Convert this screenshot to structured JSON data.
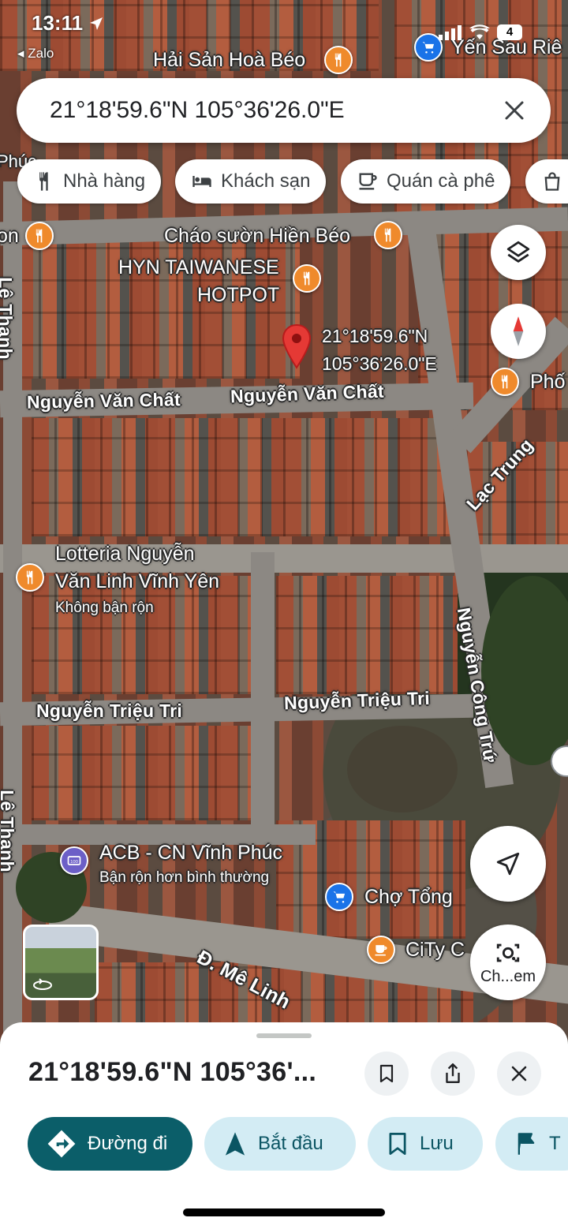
{
  "status_bar": {
    "time": "13:11",
    "back_app": "Zalo",
    "battery": "4"
  },
  "search": {
    "query": "21°18'59.6\"N 105°36'26.0\"E"
  },
  "chips": [
    {
      "label": "Nhà hàng",
      "icon": "fork-knife-icon"
    },
    {
      "label": "Khách sạn",
      "icon": "bed-icon"
    },
    {
      "label": "Quán cà phê",
      "icon": "coffee-cup-icon"
    },
    {
      "label": "",
      "icon": "shopping-bag-icon"
    }
  ],
  "map": {
    "pois": [
      {
        "name": "Hải Sản Hoà Béo",
        "type": "restaurant"
      },
      {
        "name": "Yến Sau Riê",
        "type": "shopping"
      },
      {
        "name": "Cháo sườn Hiền Béo",
        "type": "restaurant"
      },
      {
        "name_line1": "HYN TAIWANESE",
        "name_line2": "HOTPOT",
        "type": "restaurant"
      },
      {
        "name": "Phố",
        "type": "restaurant"
      },
      {
        "name_line1": "Lotteria Nguyễn",
        "name_line2": "Văn Linh Vĩnh Yên",
        "subtitle": "Không bận rộn",
        "type": "restaurant"
      },
      {
        "name": "ACB - CN Vĩnh Phúc",
        "subtitle": "Bận rộn hơn bình thường",
        "type": "bank"
      },
      {
        "name": "Chợ Tổng",
        "type": "shopping"
      },
      {
        "name": "CiTy C",
        "type": "cafe"
      },
      {
        "name": "on",
        "type": "restaurant"
      },
      {
        "name": "Phúc",
        "type": "label"
      }
    ],
    "pin": {
      "line1": "21°18'59.6\"N",
      "line2": "105°36'26.0\"E"
    },
    "roads": {
      "nguyen_van_chat_left": "Nguyễn Văn Chất",
      "nguyen_van_chat_right": "Nguyễn Văn Chất",
      "lac_trung": "Lạc Trung",
      "nguyen_trieu_tri_left": "Nguyễn Triệu Tri",
      "nguyen_trieu_tri_right": "Nguyễn Triệu Tri",
      "nguyen_cong_tru": "Nguyễn Công Trứ",
      "le_thanh_bottom": "Lê Thanh",
      "le_thanh_top": "Lê Thanh",
      "me_linh": "Đ. Mê Linh"
    },
    "camera_label": "Ch...em"
  },
  "sheet": {
    "title": "21°18'59.6\"N 105°36'...",
    "actions": [
      {
        "label": "Đường đi",
        "icon": "directions-icon"
      },
      {
        "label": "Bắt đầu",
        "icon": "navigation-arrow-icon"
      },
      {
        "label": "Lưu",
        "icon": "bookmark-icon"
      },
      {
        "label": "T",
        "icon": "flag-icon"
      }
    ]
  },
  "colors": {
    "accent_teal": "#0b5e69",
    "action_chip_bg": "#d3ecf4",
    "pin_red": "#e53935",
    "restaurant_orange": "#ef8a2c",
    "shopping_blue": "#1a73e8"
  }
}
